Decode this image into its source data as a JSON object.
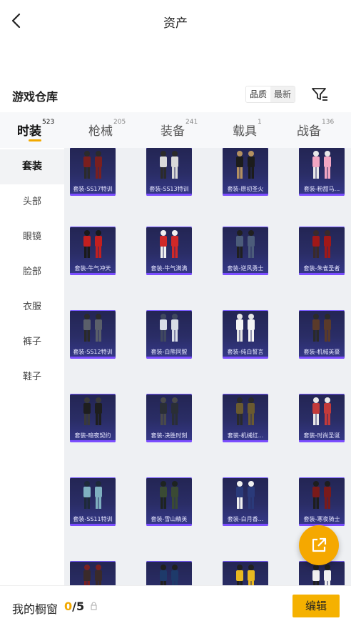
{
  "header": {
    "title": "资产"
  },
  "warehouse": {
    "title": "游戏仓库",
    "sort_options": [
      "品质",
      "最新"
    ],
    "sort_selected": "最新"
  },
  "tabs": [
    {
      "label": "时装",
      "count": "523",
      "active": true
    },
    {
      "label": "枪械",
      "count": "205"
    },
    {
      "label": "装备",
      "count": "241"
    },
    {
      "label": "载具",
      "count": "1"
    },
    {
      "label": "战备",
      "count": "136"
    }
  ],
  "sidebar": [
    {
      "label": "套装",
      "active": true
    },
    {
      "label": "头部"
    },
    {
      "label": "眼镜"
    },
    {
      "label": "脸部"
    },
    {
      "label": "衣服"
    },
    {
      "label": "裤子"
    },
    {
      "label": "鞋子"
    }
  ],
  "items": [
    "套装-SS17特训",
    "套装-SS13特训",
    "套装-原初圣火",
    "套装-粉甜马...",
    "套装-牛气冲天",
    "套装-牛气满满",
    "套装-逆风勇士",
    "套装-朱雀圣者",
    "套装-SS12特训",
    "套装-白熊同盟",
    "套装-纯白誓言",
    "套装-机械英豪",
    "套装-暗夜契约",
    "套装-决胜时刻",
    "套装-机械红...",
    "套装-时尚圣诞",
    "套装-SS11特训",
    "套装-雪山精英",
    "套装-白月香...",
    "套装-寒夜骑士",
    "",
    "",
    "",
    ""
  ],
  "bottom": {
    "window_label": "我的橱窗",
    "window_current": "0",
    "window_sep": "/",
    "window_total": "5",
    "edit_label": "编辑"
  },
  "colors": {
    "accent": "#f5a800",
    "card_bg": "#2a2d66",
    "card_stripe": "#7b4dff"
  },
  "icons": {
    "back": "chevron-left-icon",
    "filter": "filter-icon",
    "share": "external-link-icon",
    "lock": "lock-icon"
  }
}
